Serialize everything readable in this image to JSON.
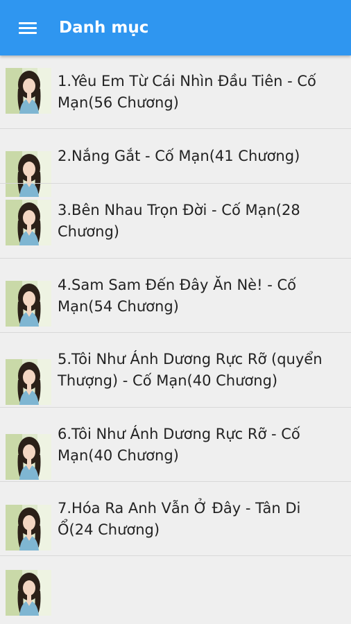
{
  "toolbar": {
    "title": "Danh mục",
    "menu_icon": "hamburger-menu-icon",
    "background_color": "#2f96f0"
  },
  "items": [
    {
      "lines": [
        "1.Yêu Em Từ Cái Nhìn Đầu Tiên - Cố",
        "Mạn(56 Chương)"
      ]
    },
    {
      "lines": [
        "2.Nắng Gắt - Cố Mạn(41 Chương)"
      ]
    },
    {
      "lines": [
        "3.Bên Nhau Trọn Đời - Cố Mạn(28",
        "Chương)"
      ]
    },
    {
      "lines": [
        "4.Sam Sam Đến Đây Ăn Nè! - Cố",
        "Mạn(54 Chương)"
      ]
    },
    {
      "lines": [
        "5.Tôi Như Ánh Dương Rực Rỡ (quyển",
        "Thượng) - Cố Mạn(40 Chương)"
      ]
    },
    {
      "lines": [
        "6.Tôi Như Ánh Dương Rực Rỡ - Cố",
        "Mạn(40 Chương)"
      ]
    },
    {
      "lines": [
        "7.Hóa Ra Anh Vẫn Ở Đây - Tân Di",
        "Ổ(24 Chương)"
      ]
    },
    {
      "lines": []
    }
  ]
}
